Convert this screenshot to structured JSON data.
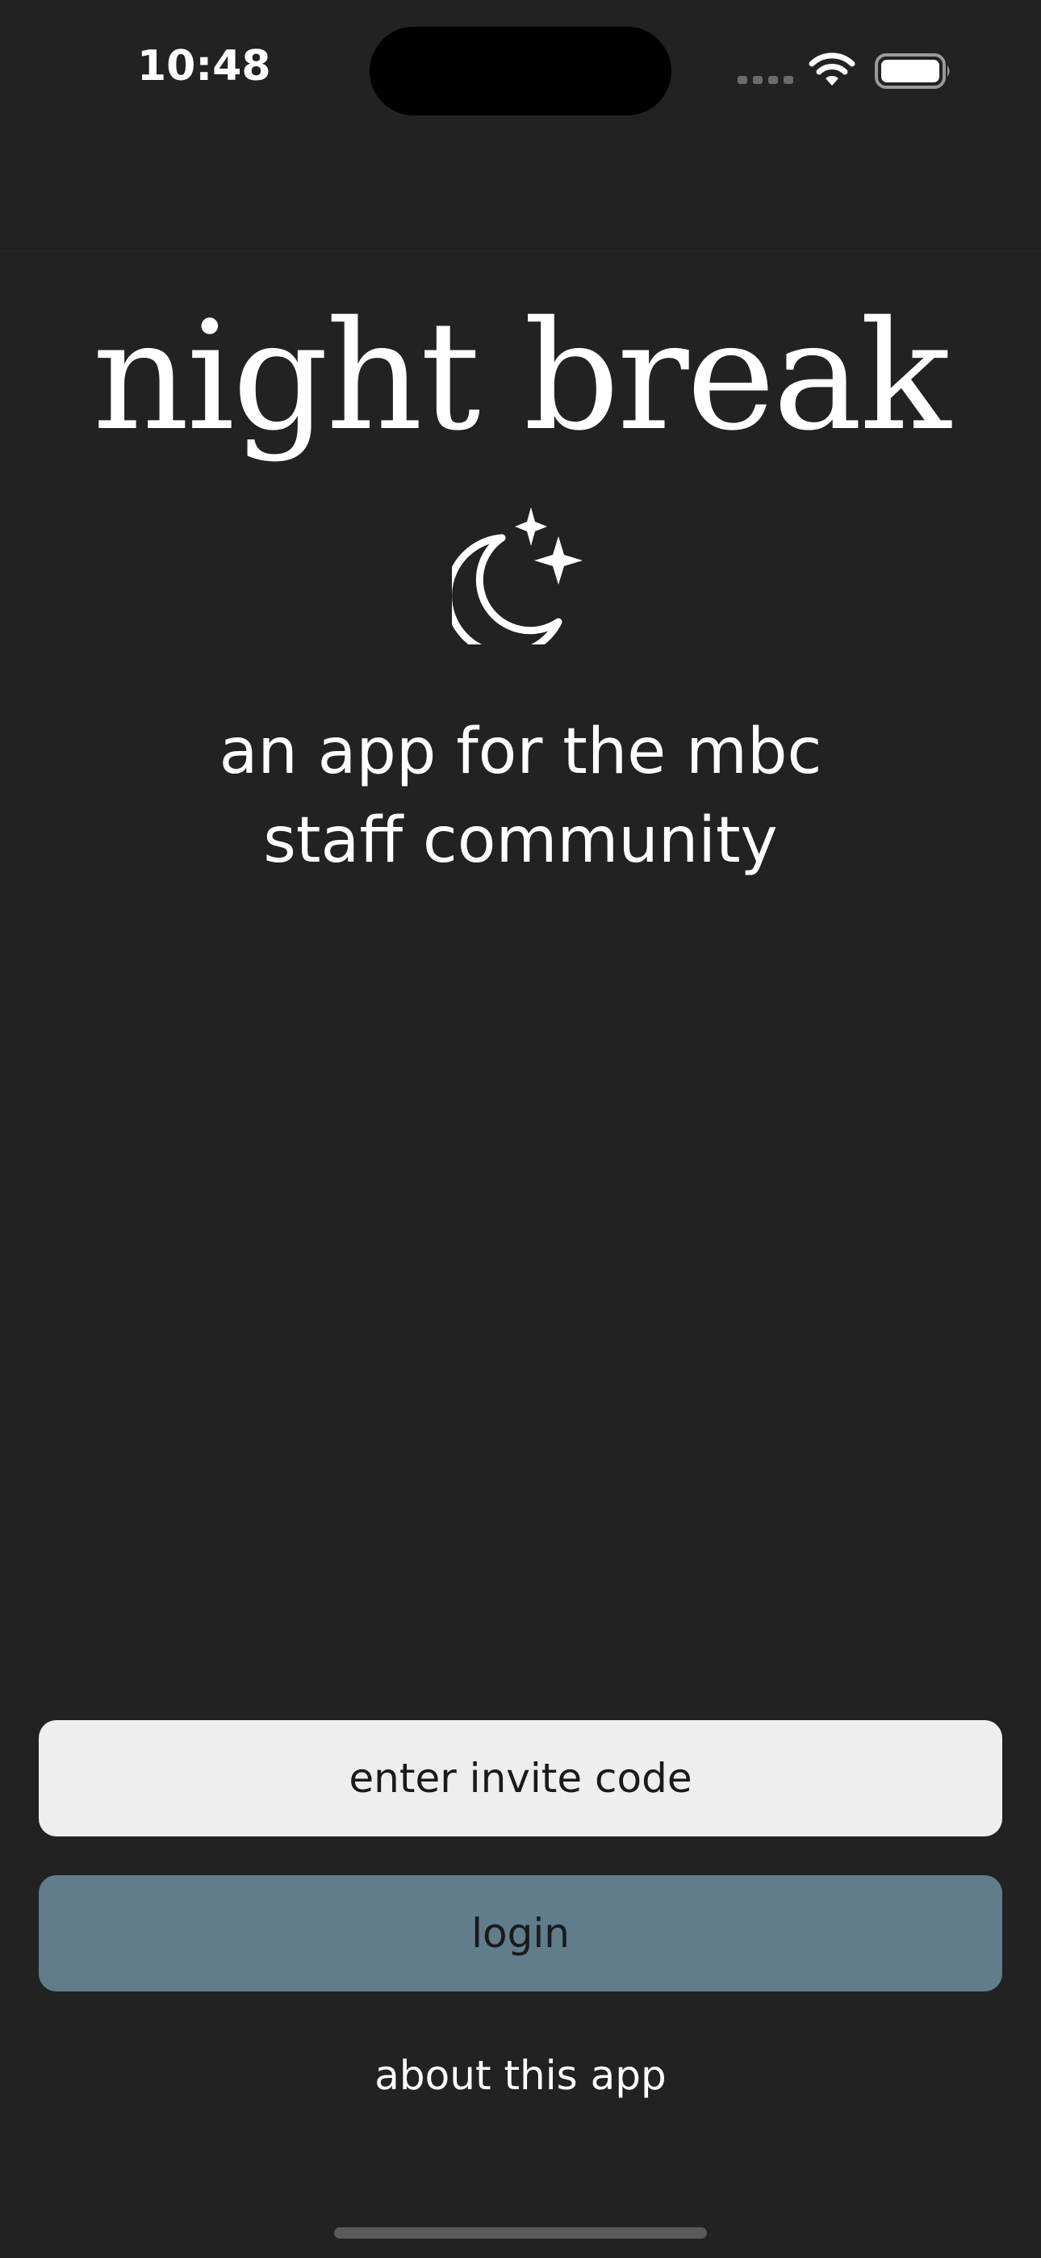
{
  "status_bar": {
    "time": "10:48",
    "icons": [
      "cellular-signal-icon",
      "wifi-icon",
      "battery-icon"
    ]
  },
  "app": {
    "title": "night break",
    "logo_icon": "moon-stars-icon",
    "tagline_line1": "an app for the mbc",
    "tagline_line2": "staff community"
  },
  "actions": {
    "invite_label": "enter invite code",
    "login_label": "login",
    "about_label": "about this app"
  },
  "colors": {
    "background": "#222222",
    "invite_button": "#eeeeee",
    "login_button": "#617c8a",
    "text_primary": "#ffffff",
    "button_text": "#1a1a1a"
  }
}
